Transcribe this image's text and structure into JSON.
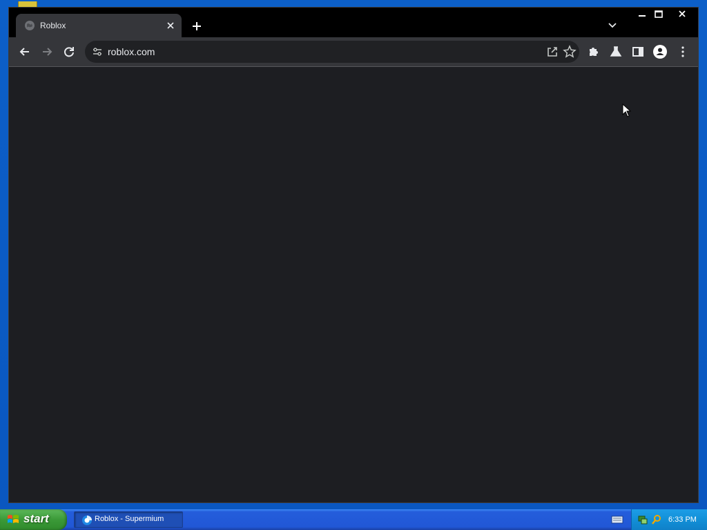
{
  "browser": {
    "tab": {
      "title": "Roblox",
      "favicon": "globe-icon"
    },
    "new_tab_icon": "plus-icon",
    "tab_search_icon": "chevron-down-icon",
    "window_controls": {
      "minimize": "minimize-icon",
      "maximize": "maximize-icon",
      "close": "close-icon"
    },
    "toolbar": {
      "back_icon": "arrow-left-icon",
      "forward_icon": "arrow-right-icon",
      "reload_icon": "reload-icon",
      "site_info_icon": "tune-icon",
      "url": "roblox.com",
      "share_icon": "share-icon",
      "bookmark_icon": "star-icon",
      "extensions_icon": "puzzle-icon",
      "labs_icon": "flask-icon",
      "side_panel_icon": "side-panel-icon",
      "profile_icon": "profile-icon",
      "menu_icon": "kebab-menu-icon"
    },
    "page": {
      "background": "#1d1e22"
    }
  },
  "taskbar": {
    "start_label": "start",
    "tasks": [
      {
        "label": "Roblox - Supermium",
        "icon": "supermium-icon"
      }
    ],
    "tray": {
      "clock": "6:33 PM",
      "icons": [
        "keyboard-icon",
        "network-icon",
        "search-icon"
      ]
    }
  },
  "colors": {
    "tabstrip": "#000000",
    "toolbar": "#35363a",
    "omnibox": "#202124",
    "taskbar": "#245ddb",
    "start": "#3b9a38",
    "tray": "#1290d8"
  }
}
